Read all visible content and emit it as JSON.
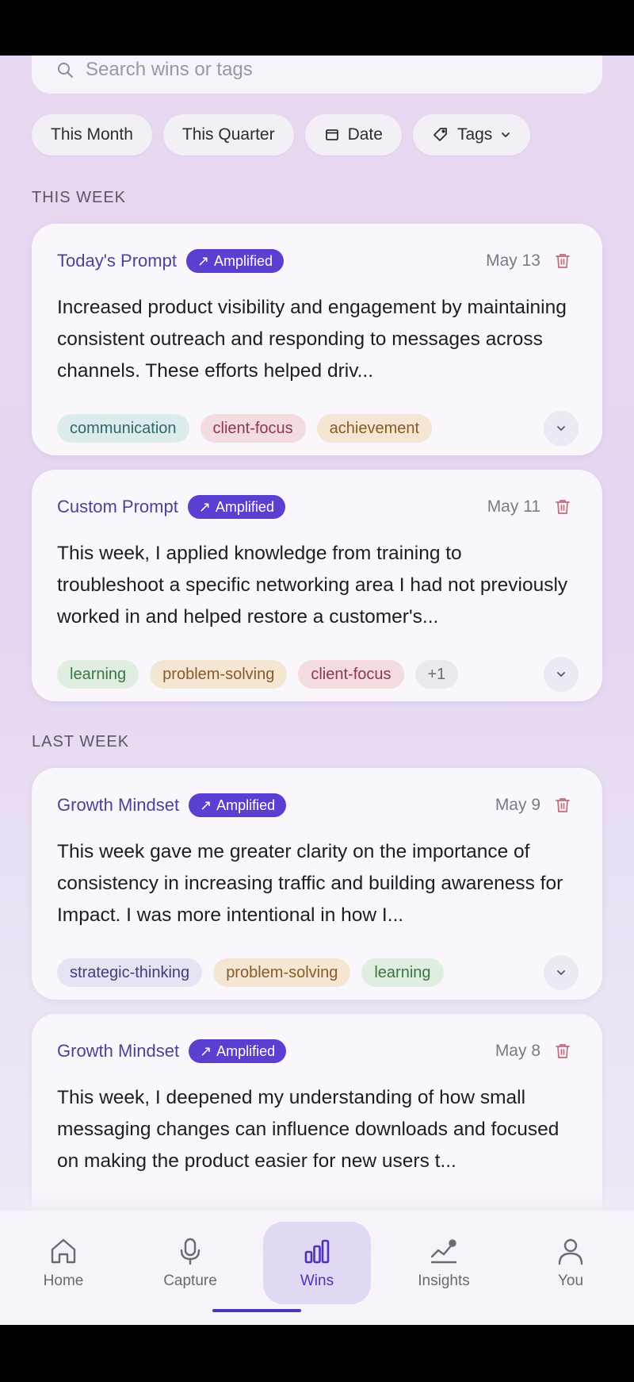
{
  "search": {
    "placeholder": "Search wins or tags"
  },
  "filters": [
    {
      "label": "This Month"
    },
    {
      "label": "This Quarter"
    },
    {
      "label": "Date",
      "icon": "calendar-icon"
    },
    {
      "label": "Tags",
      "icon": "tag-icon"
    }
  ],
  "sections": {
    "this_week": "THIS WEEK",
    "last_week": "LAST WEEK"
  },
  "badge_label": "Amplified",
  "cards": [
    {
      "prompt": "Today's Prompt",
      "date": "May 13",
      "text": "Increased product visibility and engagement by maintaining consistent outreach and responding to messages across channels. These efforts helped driv...",
      "tags": [
        "communication",
        "client-focus",
        "achievement"
      ]
    },
    {
      "prompt": "Custom Prompt",
      "date": "May 11",
      "text": "This week, I applied knowledge from training to troubleshoot a specific networking area I had not previously worked in and helped restore a customer's...",
      "tags": [
        "learning",
        "problem-solving",
        "client-focus",
        "+1"
      ]
    },
    {
      "prompt": "Growth Mindset",
      "date": "May 9",
      "text": "This week gave me greater clarity on the importance of consistency in increasing traffic and building awareness for Impact. I was more intentional in how I...",
      "tags": [
        "strategic-thinking",
        "problem-solving",
        "learning"
      ]
    },
    {
      "prompt": "Growth Mindset",
      "date": "May 8",
      "text": "This week, I deepened my understanding of how small messaging changes can influence downloads and focused on making the product easier for new users t...",
      "tags": []
    }
  ],
  "nav": {
    "home": "Home",
    "capture": "Capture",
    "wins": "Wins",
    "insights": "Insights",
    "you": "You"
  },
  "colors": {
    "accent": "#5b3fd0",
    "prompt_text": "#4f3f9a"
  }
}
